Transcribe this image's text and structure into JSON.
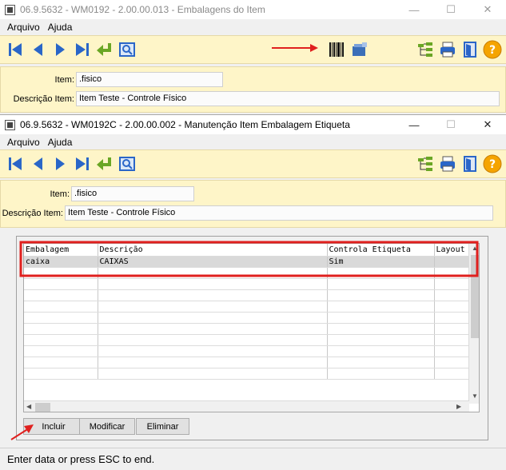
{
  "back_window": {
    "title": "06.9.5632 - WM0192 - 2.00.00.013 - Embalagens do Item",
    "menu": [
      "Arquivo",
      "Ajuda"
    ],
    "item_label": "Item:",
    "item_value": ".fisico",
    "desc_label": "Descrição Item:",
    "desc_value": "Item Teste - Controle Físico"
  },
  "front_window": {
    "title": "06.9.5632 - WM0192C - 2.00.00.002 - Manutenção Item Embalagem Etiqueta",
    "menu": [
      "Arquivo",
      "Ajuda"
    ],
    "item_label": "Item:",
    "item_value": ".fisico",
    "desc_label": "Descrição Item:",
    "desc_value": "Item Teste - Controle Físico",
    "grid": {
      "columns": [
        "Embalagem",
        "Descrição",
        "Controla Etiqueta",
        "Layout"
      ],
      "rows": [
        [
          "caixa",
          "CAIXAS",
          "Sim",
          ""
        ]
      ]
    },
    "buttons": {
      "incluir": "Incluir",
      "modificar": "Modificar",
      "eliminar": "Eliminar"
    }
  },
  "status": "Enter data or press ESC to end.",
  "colors": {
    "toolbar_bg": "#fef5c8",
    "nav_blue": "#2a66c8",
    "annotation_red": "#e0201e",
    "help_orange": "#f5a400"
  }
}
